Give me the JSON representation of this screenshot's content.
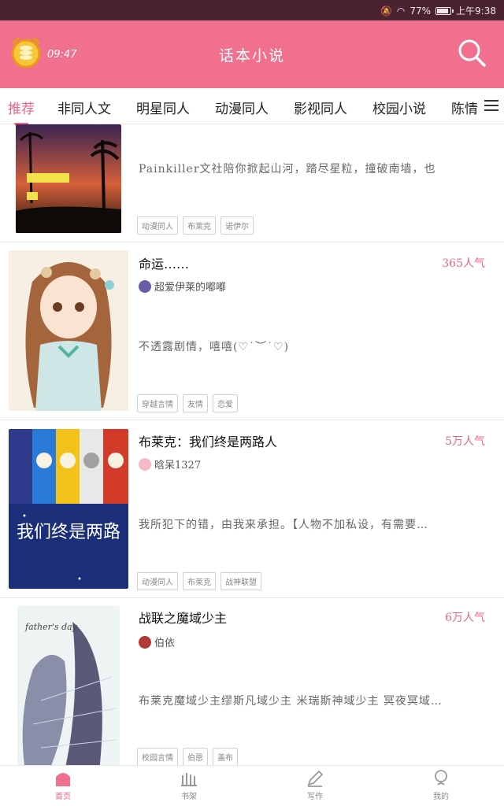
{
  "statusbar": {
    "battery": "77%",
    "time": "上午9:38"
  },
  "header": {
    "time": "09:47",
    "title": "话本小说",
    "clock_icon": "alarm-clock-icon",
    "search_icon": "search-icon"
  },
  "tabs": [
    {
      "label": "推荐",
      "active": true
    },
    {
      "label": "非同人文"
    },
    {
      "label": "明星同人"
    },
    {
      "label": "动漫同人"
    },
    {
      "label": "影视同人"
    },
    {
      "label": "校园小说"
    },
    {
      "label": "陈情"
    }
  ],
  "items": [
    {
      "title": "",
      "popularity": "",
      "author": "",
      "description": "Painkiller文社陪你掀起山河，踏尽星粒，撞破南墙，也",
      "tags": [
        "动漫同人",
        "布莱克",
        "诺伊尔"
      ]
    },
    {
      "title": "命运……",
      "popularity": "365人气",
      "author": "超爱伊莱的嘟嘟",
      "description": "不透露剧情，嘻嘻(♡˙︶˙♡)",
      "tags": [
        "穿越言情",
        "友情",
        "恋爱"
      ]
    },
    {
      "title": "布莱克：我们终是两路人",
      "popularity": "5万人气",
      "author": "晗呆1327",
      "description": "我所犯下的错，由我来承担。【人物不加私设，有需要…",
      "tags": [
        "动漫同人",
        "布莱克",
        "战神联盟"
      ],
      "cover_text": "我们终是两路"
    },
    {
      "title": "战联之魔域少主",
      "popularity": "6万人气",
      "author": "伯依",
      "description": "布莱克魔域少主缪斯凡域少主 米瑞斯神域少主 冥夜冥域…",
      "tags": [
        "校园言情",
        "伯恩",
        "盖布"
      ],
      "cover_text": "father's day"
    }
  ],
  "bottomnav": [
    {
      "label": "首页",
      "icon": "home-icon",
      "active": true
    },
    {
      "label": "书架",
      "icon": "bookshelf-icon"
    },
    {
      "label": "写作",
      "icon": "pen-icon"
    },
    {
      "label": "我的",
      "icon": "profile-icon"
    }
  ],
  "colors": {
    "accent": "#f0708e",
    "accent_text": "#e8648a",
    "statusbar": "#4a2330"
  }
}
